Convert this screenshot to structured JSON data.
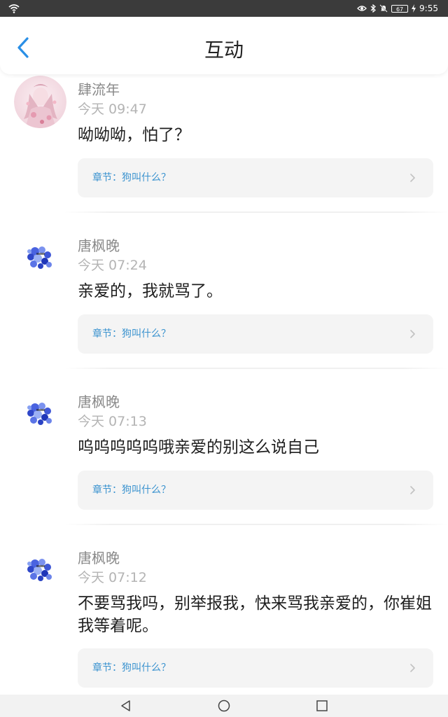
{
  "status_bar": {
    "battery": "67",
    "time": "9:55",
    "icons": [
      "wifi-icon",
      "eye-icon",
      "bluetooth-icon",
      "mute-bell-icon",
      "battery-icon",
      "charging-bolt-icon"
    ]
  },
  "header": {
    "title": "互动",
    "back_icon": "chevron-left-icon"
  },
  "colors": {
    "accent": "#3b93cf",
    "back_arrow": "#2a8fe6",
    "author_text": "#8a8a8a",
    "time_text": "#b4b4b4",
    "body_text": "#1e1e1e",
    "card_bg": "#f4f4f4"
  },
  "comments": [
    {
      "author": "肆流年",
      "time": "今天 09:47",
      "text": "呦呦呦，怕了？",
      "chapter": "章节：狗叫什么？",
      "avatar": "pink-illustration-avatar"
    },
    {
      "author": "唐枫晚",
      "time": "今天 07:24",
      "text": "亲爱的，我就骂了。",
      "chapter": "章节：狗叫什么？",
      "avatar": "blue-flowers-avatar"
    },
    {
      "author": "唐枫晚",
      "time": "今天 07:13",
      "text": "呜呜呜呜呜哦亲爱的别这么说自己",
      "chapter": "章节：狗叫什么？",
      "avatar": "blue-flowers-avatar"
    },
    {
      "author": "唐枫晚",
      "time": "今天 07:12",
      "text": "不要骂我吗，别举报我，快来骂我亲爱的，你崔姐我等着呢。",
      "chapter": "章节：狗叫什么？",
      "avatar": "blue-flowers-avatar"
    }
  ],
  "nav_bar": {
    "icons": [
      "nav-back-triangle-icon",
      "nav-home-circle-icon",
      "nav-recents-square-icon"
    ]
  }
}
